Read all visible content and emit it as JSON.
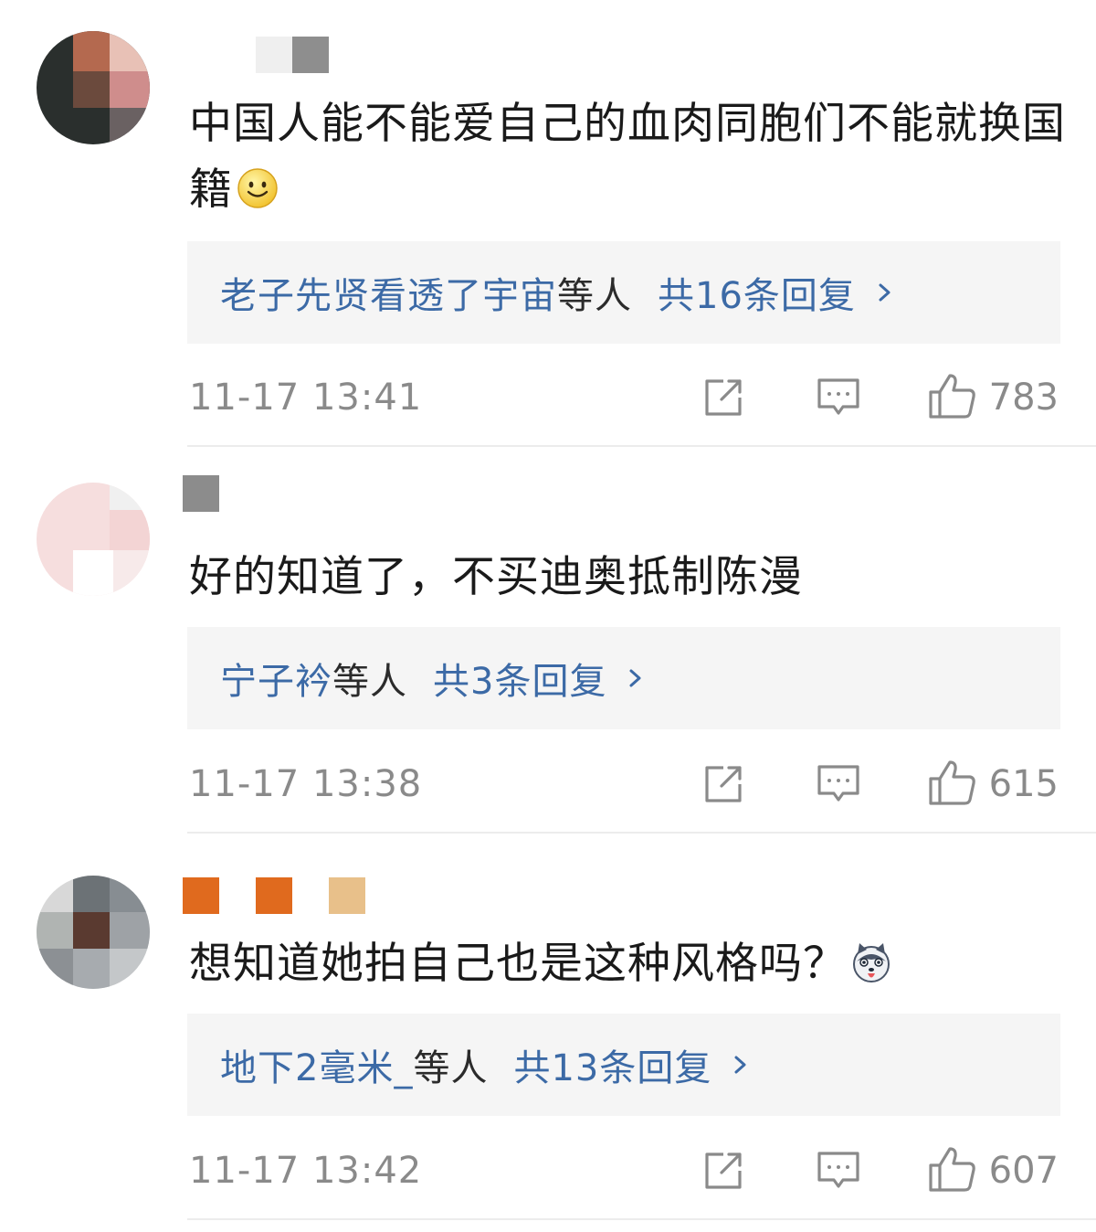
{
  "comments": [
    {
      "text": "中国人能不能爱自己的血肉同胞们不能就换国籍",
      "emoji": "smile-emoji",
      "reply_names": "老子先贤看透了宇宙",
      "reply_suffix": "等人",
      "reply_count": "共16条回复",
      "time": "11-17 13:41",
      "likes": "783"
    },
    {
      "text": "好的知道了，不买迪奥抵制陈漫",
      "reply_names": "宁子衿",
      "reply_suffix": "等人",
      "reply_count": "共3条回复",
      "time": "11-17 13:38",
      "likes": "615"
    },
    {
      "text": "想知道她拍自己也是这种风格吗？",
      "emoji": "husky-emoji",
      "reply_names": "地下2毫米_",
      "reply_suffix": "等人",
      "reply_count": "共13条回复",
      "time": "11-17 13:42",
      "likes": "607"
    }
  ],
  "icons": {
    "share": "share-icon",
    "comment": "comment-icon",
    "like": "thumbs-up-icon"
  },
  "colors": {
    "link_blue": "#3c6aa6",
    "meta_gray": "#8a8a8a",
    "reply_bg": "#f5f5f5"
  }
}
